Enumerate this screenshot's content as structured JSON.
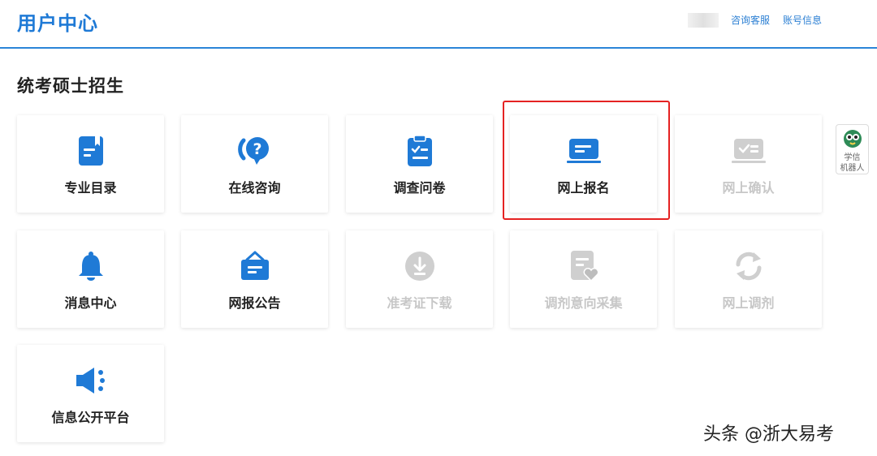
{
  "header": {
    "title": "用户中心",
    "links": {
      "consult": "咨询客服",
      "account": "账号信息"
    }
  },
  "section": {
    "title": "统考硕士招生"
  },
  "cards": [
    {
      "label": "专业目录",
      "icon": "book-icon",
      "enabled": true
    },
    {
      "label": "在线咨询",
      "icon": "question-chat-icon",
      "enabled": true
    },
    {
      "label": "调查问卷",
      "icon": "clipboard-check-icon",
      "enabled": true
    },
    {
      "label": "网上报名",
      "icon": "laptop-form-icon",
      "enabled": true,
      "highlighted": true
    },
    {
      "label": "网上确认",
      "icon": "screen-check-icon",
      "enabled": false
    },
    {
      "label": "消息中心",
      "icon": "bell-icon",
      "enabled": true
    },
    {
      "label": "网报公告",
      "icon": "notice-board-icon",
      "enabled": true
    },
    {
      "label": "准考证下载",
      "icon": "download-icon",
      "enabled": false
    },
    {
      "label": "调剂意向采集",
      "icon": "document-heart-icon",
      "enabled": false
    },
    {
      "label": "网上调剂",
      "icon": "refresh-icon",
      "enabled": false
    },
    {
      "label": "信息公开平台",
      "icon": "megaphone-icon",
      "enabled": true
    }
  ],
  "assistant": {
    "label_line1": "学信",
    "label_line2": "机器人"
  },
  "watermark": "头条 @浙大易考",
  "colors": {
    "primary": "#1f7ad6",
    "disabled": "#c7c7c7",
    "highlight": "#e52222"
  }
}
